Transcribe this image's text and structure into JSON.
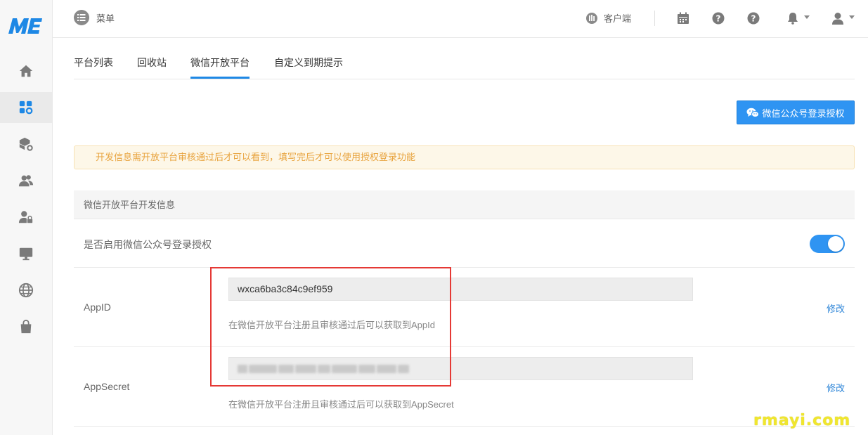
{
  "brand": {
    "logo_text": "ME",
    "accent": "#1e88e5"
  },
  "sidebar": {
    "items": [
      {
        "icon": "home-icon"
      },
      {
        "icon": "apps-gear-icon",
        "active": true
      },
      {
        "icon": "box-gear-icon"
      },
      {
        "icon": "users-icon"
      },
      {
        "icon": "user-lock-icon"
      },
      {
        "icon": "monitor-icon"
      },
      {
        "icon": "globe-icon"
      },
      {
        "icon": "shopping-bag-icon"
      }
    ]
  },
  "header": {
    "menu_label": "菜单",
    "client_label": "客户端",
    "icons": [
      "calendar-icon",
      "help-circle-icon",
      "help-icon",
      "bell-icon",
      "user-icon"
    ]
  },
  "tabs": [
    {
      "label": "平台列表"
    },
    {
      "label": "回收站"
    },
    {
      "label": "微信开放平台",
      "active": true
    },
    {
      "label": "自定义到期提示"
    }
  ],
  "auth_button": {
    "label": "微信公众号登录授权"
  },
  "alert": {
    "text": "开发信息需开放平台审核通过后才可以看到，填写完后才可以使用授权登录功能",
    "color": "#e8a33d"
  },
  "panel": {
    "title": "微信开放平台开发信息",
    "enable_row": {
      "label": "是否启用微信公众号登录授权",
      "enabled": true
    },
    "appid_row": {
      "label": "AppID",
      "value": "wxca6ba3c84c9ef959",
      "help": "在微信开放平台注册且审核通过后可以获取到AppId",
      "edit_label": "修改"
    },
    "appsecret_row": {
      "label": "AppSecret",
      "value": "",
      "help": "在微信开放平台注册且审核通过后可以获取到AppSecret",
      "edit_label": "修改"
    }
  },
  "watermark": "rmayi.com"
}
